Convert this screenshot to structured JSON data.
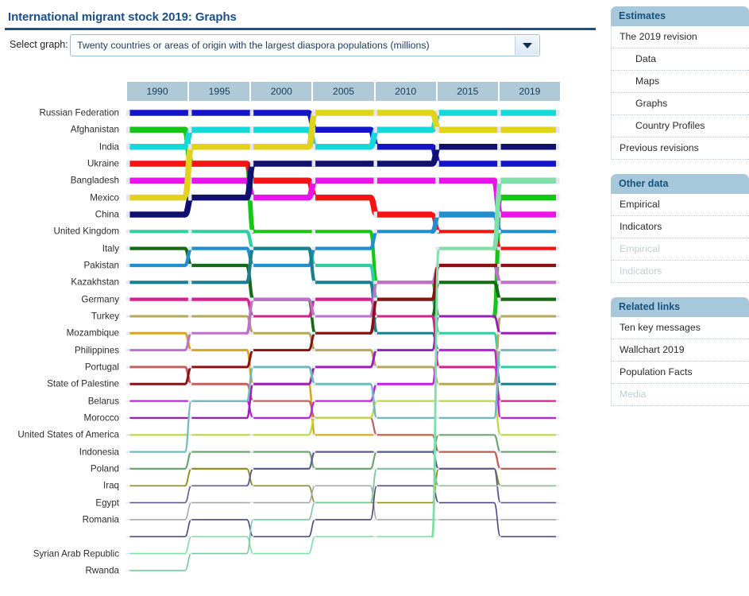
{
  "page": {
    "title": "International migrant stock 2019: Graphs"
  },
  "controls": {
    "select_label": "Select graph:",
    "selected_graph": "Twenty countries or areas of origin with the largest diaspora populations (millions)",
    "dropdown_icon": "chevron-down-icon"
  },
  "sidebar": {
    "panels": [
      {
        "title": "Estimates",
        "items": [
          {
            "label": "The 2019 revision",
            "indent": false,
            "disabled": false
          },
          {
            "label": "Data",
            "indent": true,
            "disabled": false
          },
          {
            "label": "Maps",
            "indent": true,
            "disabled": false
          },
          {
            "label": "Graphs",
            "indent": true,
            "disabled": false
          },
          {
            "label": "Country Profiles",
            "indent": true,
            "disabled": false
          },
          {
            "label": "Previous revisions",
            "indent": false,
            "disabled": false
          }
        ]
      },
      {
        "title": "Other data",
        "items": [
          {
            "label": "Empirical",
            "indent": false,
            "disabled": false
          },
          {
            "label": "Indicators",
            "indent": false,
            "disabled": false
          },
          {
            "label": "Empirical",
            "indent": false,
            "disabled": true
          },
          {
            "label": "Indicators",
            "indent": false,
            "disabled": true
          }
        ]
      },
      {
        "title": "Related links",
        "items": [
          {
            "label": "Ten key messages",
            "indent": false,
            "disabled": false
          },
          {
            "label": "Wallchart 2019",
            "indent": false,
            "disabled": false
          },
          {
            "label": "Population Facts",
            "indent": false,
            "disabled": false
          },
          {
            "label": "Media",
            "indent": false,
            "disabled": true
          }
        ]
      }
    ]
  },
  "chart_data": {
    "type": "line",
    "subtype": "bump-rank-chart",
    "title": "Twenty countries or areas of origin with the largest diaspora populations (millions)",
    "xlabel": "",
    "ylabel": "",
    "categories": [
      "1990",
      "1995",
      "2000",
      "2005",
      "2010",
      "2015",
      "2019"
    ],
    "x": [
      1990,
      1995,
      2000,
      2005,
      2010,
      2015,
      2019
    ],
    "ylim": [
      1,
      26
    ],
    "y_inverted": true,
    "grid": false,
    "legend": "none",
    "note": "values are rank positions (1 = largest diaspora); null = not in chart at that year",
    "series": [
      {
        "name": "Russian Federation",
        "color": "#1414c8",
        "values": [
          1,
          1,
          1,
          2,
          3,
          4,
          4
        ]
      },
      {
        "name": "Afghanistan",
        "color": "#16c614",
        "values": [
          2,
          4,
          8,
          8,
          11,
          13,
          6
        ]
      },
      {
        "name": "India",
        "color": "#15d8d8",
        "values": [
          3,
          2,
          2,
          3,
          2,
          1,
          1
        ]
      },
      {
        "name": "Ukraine",
        "color": "#f51414",
        "values": [
          4,
          4,
          5,
          6,
          7,
          8,
          9
        ]
      },
      {
        "name": "Bangladesh",
        "color": "#e815e8",
        "values": [
          5,
          5,
          6,
          5,
          5,
          5,
          7
        ]
      },
      {
        "name": "Mexico",
        "color": "#e0d319",
        "values": [
          6,
          3,
          3,
          1,
          1,
          2,
          2
        ]
      },
      {
        "name": "China",
        "color": "#101070",
        "values": [
          7,
          6,
          4,
          4,
          4,
          3,
          3
        ]
      },
      {
        "name": "United Kingdom",
        "color": "#2fcfa0",
        "values": [
          8,
          8,
          9,
          10,
          12,
          14,
          16
        ]
      },
      {
        "name": "Italy",
        "color": "#146b14",
        "values": [
          9,
          10,
          12,
          14,
          13,
          11,
          12
        ]
      },
      {
        "name": "Pakistan",
        "color": "#1f8fd0",
        "values": [
          10,
          9,
          10,
          9,
          8,
          7,
          8
        ]
      },
      {
        "name": "Kazakhstan",
        "color": "#1a8090",
        "values": [
          11,
          11,
          9,
          11,
          14,
          15,
          17
        ]
      },
      {
        "name": "Germany",
        "color": "#d6218a",
        "values": [
          12,
          12,
          13,
          12,
          13,
          16,
          18
        ]
      },
      {
        "name": "Turkey",
        "color": "#b5a85a",
        "values": [
          13,
          13,
          14,
          15,
          16,
          17,
          13
        ]
      },
      {
        "name": "Mozambique",
        "color": "#d3a81f",
        "values": [
          14,
          15,
          17,
          20,
          20,
          21,
          22
        ]
      },
      {
        "name": "Philippines",
        "color": "#bb72c8",
        "values": [
          15,
          14,
          12,
          13,
          11,
          10,
          11
        ]
      },
      {
        "name": "Portugal",
        "color": "#c06060",
        "values": [
          16,
          17,
          18,
          19,
          20,
          21,
          22
        ]
      },
      {
        "name": "State of Palestine",
        "color": "#8b1212",
        "values": [
          17,
          16,
          15,
          14,
          12,
          10,
          10
        ]
      },
      {
        "name": "Belarus",
        "color": "#c020e0",
        "values": [
          18,
          18,
          19,
          18,
          17,
          15,
          19
        ]
      },
      {
        "name": "Morocco",
        "color": "#9b1fb5",
        "values": [
          19,
          19,
          17,
          16,
          15,
          13,
          14
        ]
      },
      {
        "name": "United States of America",
        "color": "#b8d943",
        "values": [
          20,
          20,
          20,
          19,
          18,
          18,
          20
        ]
      },
      {
        "name": "Indonesia",
        "color": "#72b9bd",
        "values": [
          21,
          18,
          16,
          17,
          19,
          19,
          15
        ]
      },
      {
        "name": "Poland",
        "color": "#6fa572",
        "values": [
          22,
          21,
          21,
          22,
          21,
          20,
          21
        ]
      },
      {
        "name": "Iraq",
        "color": "#8f8f1a",
        "values": [
          23,
          22,
          23,
          24,
          24,
          22,
          23
        ]
      },
      {
        "name": "Egypt",
        "color": "#5f5f8f",
        "values": [
          24,
          23,
          22,
          21,
          21,
          22,
          24
        ]
      },
      {
        "name": "Romania",
        "color": "#a8a8a8",
        "values": [
          25,
          24,
          24,
          23,
          25,
          25,
          25
        ]
      },
      {
        "name": "",
        "color": "#4a4a80",
        "values": [
          26,
          25,
          26,
          25,
          23,
          24,
          26
        ]
      },
      {
        "name": "Syrian Arab Republic",
        "color": "#7ee0a8",
        "values": [
          27,
          26,
          27,
          26,
          26,
          9,
          5
        ]
      },
      {
        "name": "Rwanda",
        "color": "#7fc7a0",
        "values": [
          28,
          27,
          25,
          24,
          22,
          23,
          23
        ]
      }
    ]
  }
}
